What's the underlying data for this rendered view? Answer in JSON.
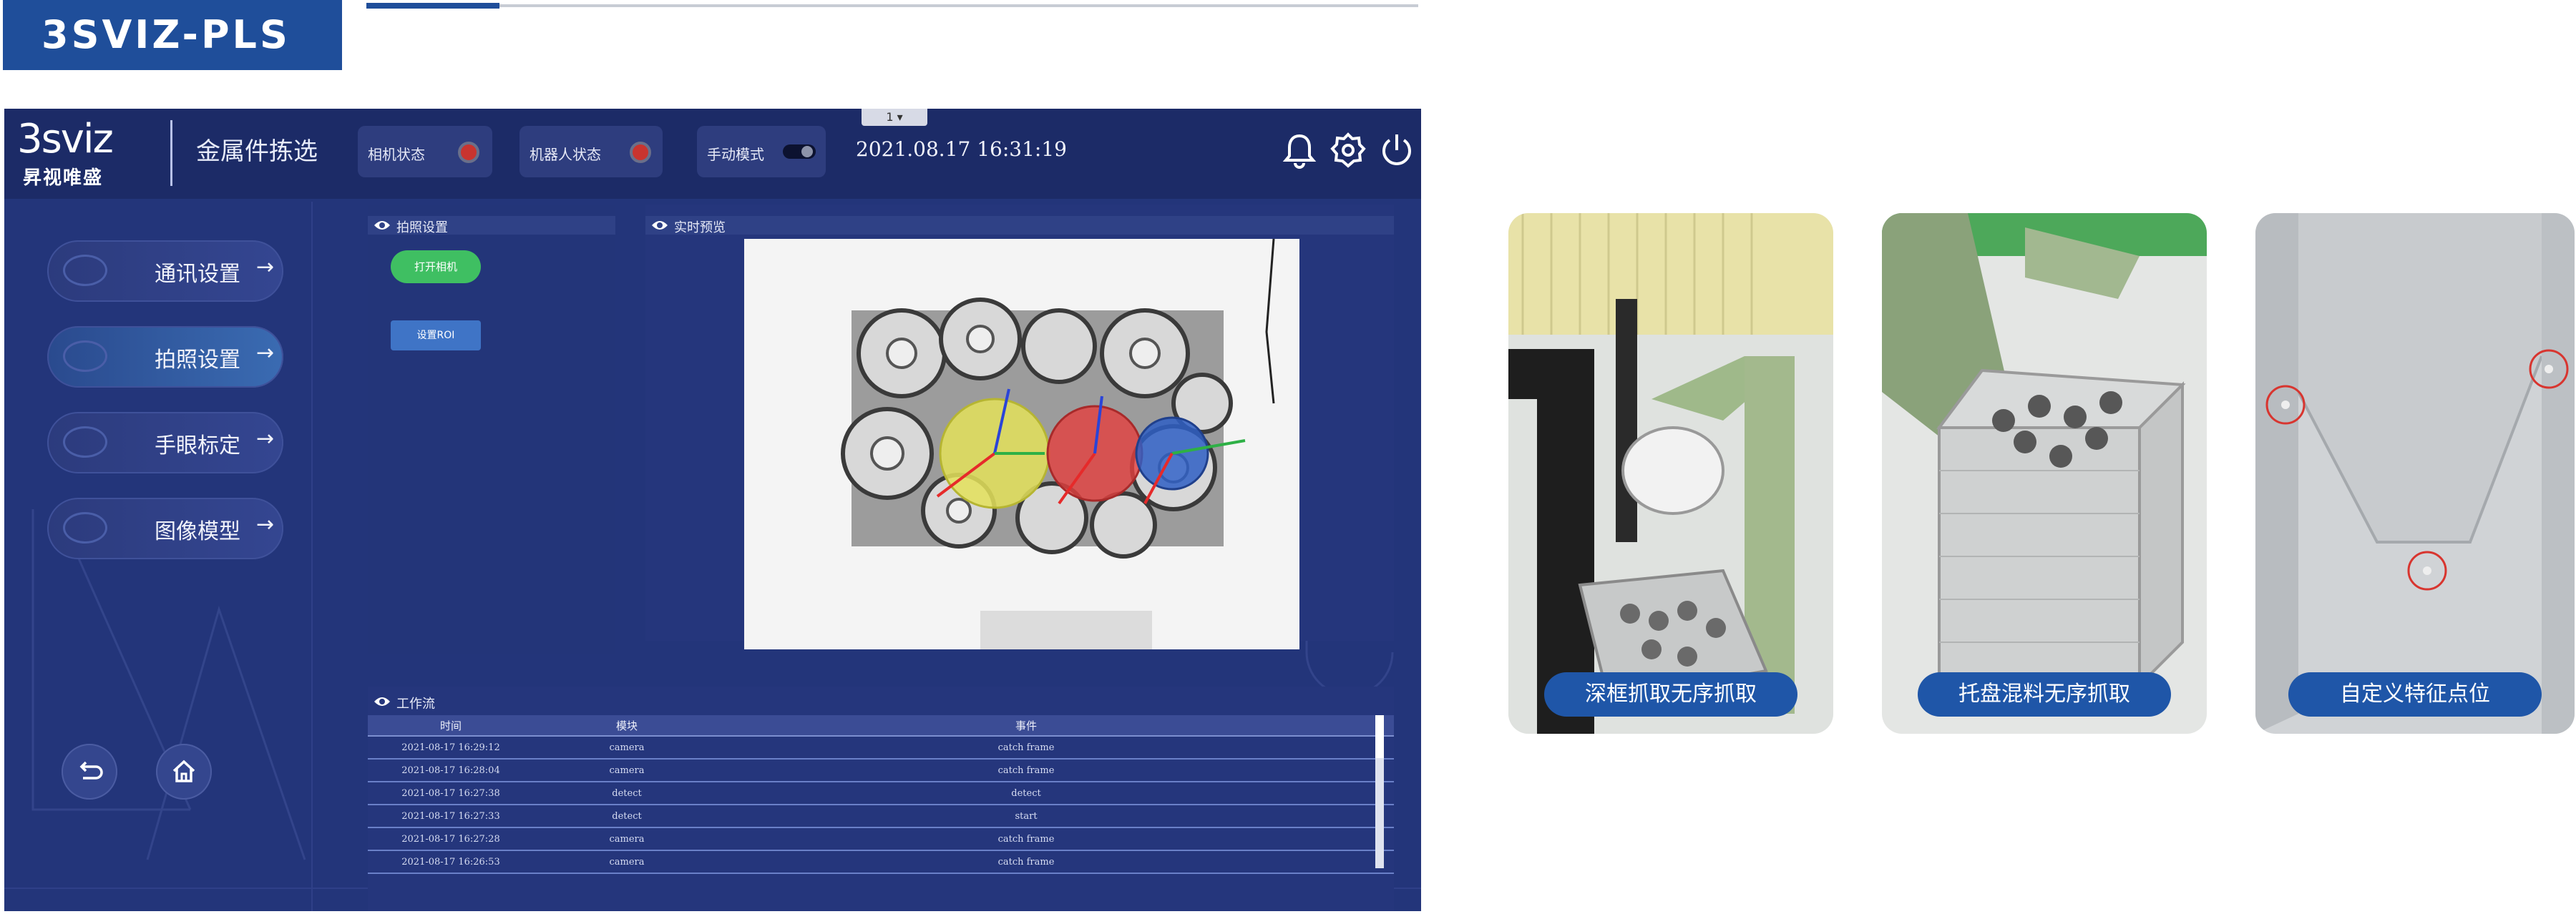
{
  "brand": {
    "title": "3SVIZ-PLS"
  },
  "app": {
    "logo_main": "3sviz",
    "logo_sub": "昇视唯盛",
    "title": "金属件拣选",
    "dropdown": "1 ▾",
    "status": {
      "camera": "相机状态",
      "robot": "机器人状态",
      "manual": "手动模式"
    },
    "datetime": "2021.08.17 16:31:19",
    "icons": {
      "bell": "bell-icon",
      "settings": "gear-icon",
      "power": "power-icon"
    }
  },
  "sidebar": {
    "items": [
      {
        "label": "通讯设置"
      },
      {
        "label": "拍照设置"
      },
      {
        "label": "手眼标定"
      },
      {
        "label": "图像模型"
      }
    ],
    "arrow": "→"
  },
  "settings_panel": {
    "title": "拍照设置",
    "open_camera": "打开相机",
    "set_roi": "设置ROI"
  },
  "preview_panel": {
    "title": "实时预览"
  },
  "workflow": {
    "title": "工作流",
    "columns": [
      "时间",
      "模块",
      "事件"
    ],
    "rows": [
      [
        "2021-08-17 16:29:12",
        "camera",
        "catch frame"
      ],
      [
        "2021-08-17 16:28:04",
        "camera",
        "catch frame"
      ],
      [
        "2021-08-17 16:27:38",
        "detect",
        "detect"
      ],
      [
        "2021-08-17 16:27:33",
        "detect",
        "start"
      ],
      [
        "2021-08-17 16:27:28",
        "camera",
        "catch frame"
      ],
      [
        "2021-08-17 16:26:53",
        "camera",
        "catch frame"
      ]
    ]
  },
  "cards": [
    {
      "label": "深框抓取无序抓取"
    },
    {
      "label": "托盘混料无序抓取"
    },
    {
      "label": "自定义特征点位"
    }
  ],
  "colors": {
    "brand_blue": "#1f4e9a",
    "app_bg": "#23357a",
    "card_label": "#1f56a8",
    "led_red": "#c9342f",
    "button_green": "#3fbf62"
  }
}
